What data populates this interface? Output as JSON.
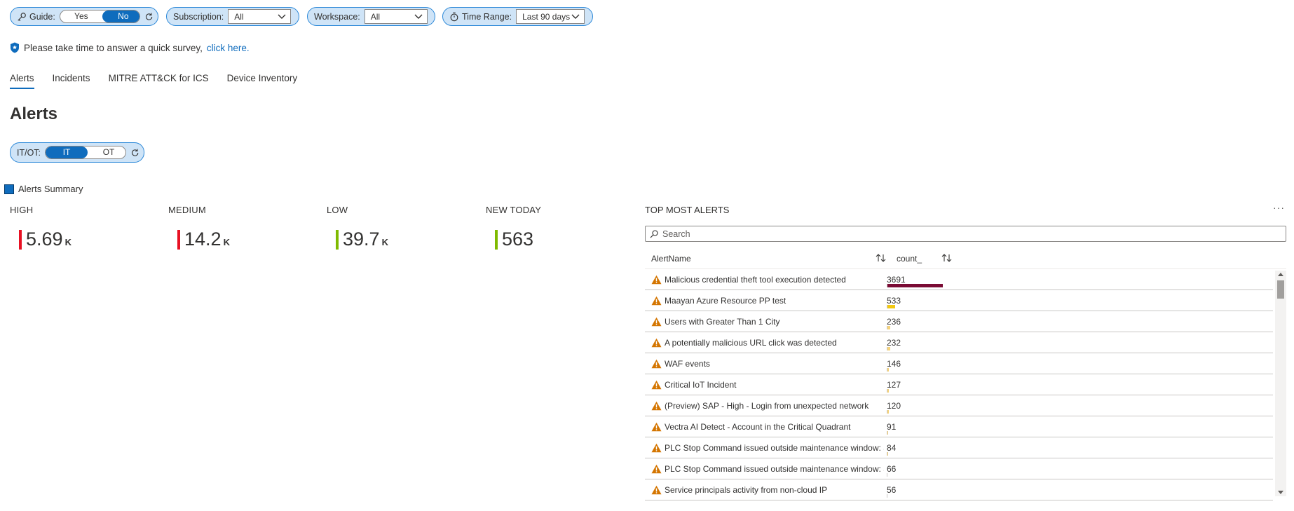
{
  "params": {
    "guide": {
      "label": "Guide:",
      "options": [
        "Yes",
        "No"
      ],
      "selected": "No"
    },
    "subscription": {
      "label": "Subscription:",
      "value": "All"
    },
    "workspace": {
      "label": "Workspace:",
      "value": "All"
    },
    "time_range": {
      "label": "Time Range:",
      "value": "Last 90 days"
    },
    "itot": {
      "label": "IT/OT:",
      "options": [
        "IT",
        "OT"
      ],
      "selected": "IT"
    }
  },
  "survey": {
    "text": "Please take time to answer a quick survey,",
    "link": "click here."
  },
  "tabs": [
    "Alerts",
    "Incidents",
    "MITRE ATT&CK for ICS",
    "Device Inventory"
  ],
  "active_tab": "Alerts",
  "section_title": "Alerts",
  "summary": {
    "title": "Alerts Summary",
    "tiles": [
      {
        "label": "HIGH",
        "value": "5.69",
        "unit": "K",
        "color": "#e81123"
      },
      {
        "label": "MEDIUM",
        "value": "14.2",
        "unit": "K",
        "color": "#e81123"
      },
      {
        "label": "LOW",
        "value": "39.7",
        "unit": "K",
        "color": "#7fba00"
      },
      {
        "label": "NEW TODAY",
        "value": "563",
        "unit": "",
        "color": "#7fba00"
      }
    ]
  },
  "top_alerts": {
    "title": "TOP MOST ALERTS",
    "more": "···",
    "search_placeholder": "Search",
    "columns": [
      "AlertName",
      "count_"
    ],
    "rows": [
      {
        "name": "Malicious credential theft tool execution detected",
        "count": 3691
      },
      {
        "name": "Maayan Azure Resource PP test",
        "count": 533
      },
      {
        "name": "Users with Greater Than 1 City",
        "count": 236
      },
      {
        "name": "A potentially malicious URL click was detected",
        "count": 232
      },
      {
        "name": "WAF events",
        "count": 146
      },
      {
        "name": "Critical IoT Incident",
        "count": 127
      },
      {
        "name": "(Preview) SAP - High - Login from unexpected network",
        "count": 120
      },
      {
        "name": "Vectra AI Detect - Account in the Critical Quadrant",
        "count": 91
      },
      {
        "name": "PLC Stop Command issued outside maintenance window: S",
        "count": 84
      },
      {
        "name": "PLC Stop Command issued outside maintenance window: S",
        "count": 66
      },
      {
        "name": "Service principals activity from non-cloud IP",
        "count": 56
      }
    ],
    "bar_colors": {
      "max": "#7a0b34",
      "mid": "#f2c811",
      "low": "#f7d47a"
    }
  }
}
